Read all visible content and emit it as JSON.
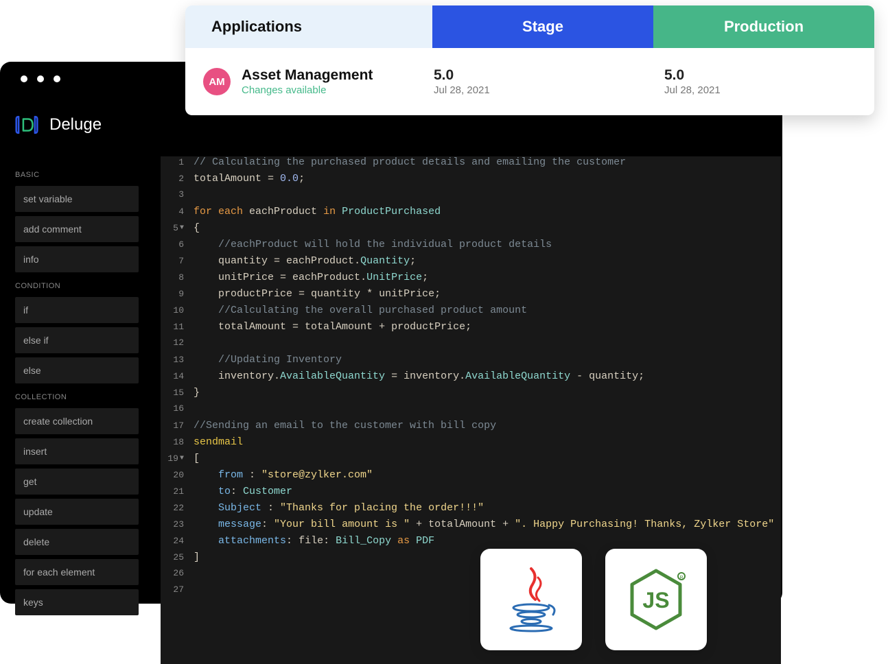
{
  "header": {
    "tabs": {
      "applications": "Applications",
      "stage": "Stage",
      "production": "Production"
    },
    "app": {
      "initials": "AM",
      "name": "Asset Management",
      "status": "Changes available"
    },
    "stage": {
      "version": "5.0",
      "date": "Jul 28, 2021"
    },
    "production": {
      "version": "5.0",
      "date": "Jul 28, 2021"
    }
  },
  "brand": "Deluge",
  "sidebar": {
    "basic": {
      "title": "BASIC",
      "items": [
        "set variable",
        "add comment",
        "info"
      ]
    },
    "condition": {
      "title": "CONDITION",
      "items": [
        "if",
        "else if",
        "else"
      ]
    },
    "collection": {
      "title": "COLLECTION",
      "items": [
        "create collection",
        "insert",
        "get",
        "update",
        "delete",
        "for each element",
        "keys"
      ]
    }
  },
  "code": {
    "lines": [
      {
        "n": 1,
        "tokens": [
          [
            "comment",
            "// Calculating the purchased product details and emailing the customer"
          ]
        ]
      },
      {
        "n": 2,
        "tokens": [
          [
            "var",
            "totalAmount"
          ],
          [
            "op",
            " = "
          ],
          [
            "num",
            "0.0"
          ],
          [
            "punc",
            ";"
          ]
        ]
      },
      {
        "n": 3,
        "tokens": []
      },
      {
        "n": 4,
        "tokens": [
          [
            "key",
            "for each"
          ],
          [
            "op",
            " "
          ],
          [
            "var",
            "eachProduct"
          ],
          [
            "op",
            " "
          ],
          [
            "in",
            "in"
          ],
          [
            "op",
            " "
          ],
          [
            "ident",
            "ProductPurchased"
          ]
        ]
      },
      {
        "n": 5,
        "fold": true,
        "tokens": [
          [
            "punc",
            "{"
          ]
        ]
      },
      {
        "n": 6,
        "indent": 1,
        "tokens": [
          [
            "comment",
            "//eachProduct will hold the individual product details"
          ]
        ]
      },
      {
        "n": 7,
        "indent": 1,
        "tokens": [
          [
            "var",
            "quantity"
          ],
          [
            "op",
            " = "
          ],
          [
            "var",
            "eachProduct"
          ],
          [
            "punc",
            "."
          ],
          [
            "ident",
            "Quantity"
          ],
          [
            "punc",
            ";"
          ]
        ]
      },
      {
        "n": 8,
        "indent": 1,
        "tokens": [
          [
            "var",
            "unitPrice"
          ],
          [
            "op",
            " = "
          ],
          [
            "var",
            "eachProduct"
          ],
          [
            "punc",
            "."
          ],
          [
            "ident",
            "UnitPrice"
          ],
          [
            "punc",
            ";"
          ]
        ]
      },
      {
        "n": 9,
        "indent": 1,
        "tokens": [
          [
            "var",
            "productPrice"
          ],
          [
            "op",
            " = "
          ],
          [
            "var",
            "quantity"
          ],
          [
            "op",
            " * "
          ],
          [
            "var",
            "unitPrice"
          ],
          [
            "punc",
            ";"
          ]
        ]
      },
      {
        "n": 10,
        "indent": 1,
        "tokens": [
          [
            "comment",
            "//Calculating the overall purchased product amount"
          ]
        ]
      },
      {
        "n": 11,
        "indent": 1,
        "tokens": [
          [
            "var",
            "totalAmount"
          ],
          [
            "op",
            " = "
          ],
          [
            "var",
            "totalAmount"
          ],
          [
            "op",
            " + "
          ],
          [
            "var",
            "productPrice"
          ],
          [
            "punc",
            ";"
          ]
        ]
      },
      {
        "n": 12,
        "tokens": []
      },
      {
        "n": 13,
        "indent": 1,
        "tokens": [
          [
            "comment",
            "//Updating Inventory"
          ]
        ]
      },
      {
        "n": 14,
        "indent": 1,
        "tokens": [
          [
            "var",
            "inventory"
          ],
          [
            "punc",
            "."
          ],
          [
            "ident",
            "AvailableQuantity"
          ],
          [
            "op",
            " = "
          ],
          [
            "var",
            "inventory"
          ],
          [
            "punc",
            "."
          ],
          [
            "ident",
            "AvailableQuantity"
          ],
          [
            "op",
            " - "
          ],
          [
            "var",
            "quantity"
          ],
          [
            "punc",
            ";"
          ]
        ]
      },
      {
        "n": 15,
        "tokens": [
          [
            "punc",
            "}"
          ]
        ]
      },
      {
        "n": 16,
        "tokens": []
      },
      {
        "n": 17,
        "tokens": [
          [
            "comment",
            "//Sending an email to the customer with bill copy"
          ]
        ]
      },
      {
        "n": 18,
        "tokens": [
          [
            "send",
            "sendmail"
          ]
        ]
      },
      {
        "n": 19,
        "fold": true,
        "tokens": [
          [
            "punc",
            "["
          ]
        ]
      },
      {
        "n": 20,
        "indent": 1,
        "tokens": [
          [
            "field",
            "from"
          ],
          [
            "op",
            " : "
          ],
          [
            "str",
            "\"store@zylker.com\""
          ]
        ]
      },
      {
        "n": 21,
        "indent": 1,
        "tokens": [
          [
            "field",
            "to"
          ],
          [
            "punc",
            ":"
          ],
          [
            "op",
            " "
          ],
          [
            "ident",
            "Customer"
          ]
        ]
      },
      {
        "n": 22,
        "indent": 1,
        "tokens": [
          [
            "field",
            "Subject"
          ],
          [
            "op",
            " : "
          ],
          [
            "str",
            "\"Thanks for placing the order!!!\""
          ]
        ]
      },
      {
        "n": 23,
        "indent": 1,
        "tokens": [
          [
            "field",
            "message"
          ],
          [
            "punc",
            ":"
          ],
          [
            "op",
            " "
          ],
          [
            "str",
            "\"Your bill amount is \""
          ],
          [
            "op",
            " + "
          ],
          [
            "var",
            "totalAmount"
          ],
          [
            "op",
            " + "
          ],
          [
            "str",
            "\". Happy Purchasing! Thanks, Zylker Store\""
          ]
        ]
      },
      {
        "n": 24,
        "indent": 1,
        "tokens": [
          [
            "field",
            "attachments"
          ],
          [
            "punc",
            ":"
          ],
          [
            "op",
            " "
          ],
          [
            "var",
            "file"
          ],
          [
            "punc",
            ":"
          ],
          [
            "op",
            " "
          ],
          [
            "ident",
            "Bill_Copy"
          ],
          [
            "op",
            " "
          ],
          [
            "as",
            "as"
          ],
          [
            "op",
            " "
          ],
          [
            "ident",
            "PDF"
          ]
        ]
      },
      {
        "n": 25,
        "tokens": [
          [
            "punc",
            "]"
          ]
        ]
      },
      {
        "n": 26,
        "tokens": []
      },
      {
        "n": 27,
        "tokens": []
      }
    ]
  },
  "tiles": {
    "java": "Java",
    "node": "Node.js"
  }
}
